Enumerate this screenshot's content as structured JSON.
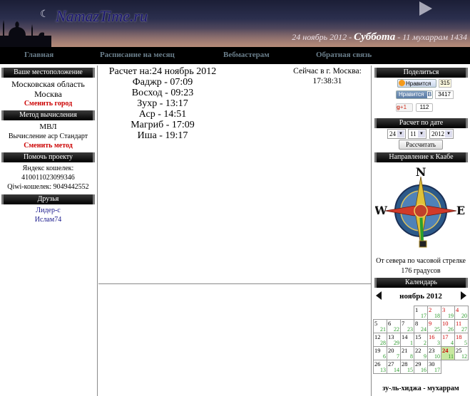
{
  "site": {
    "logo": "NamazTime.ru"
  },
  "header": {
    "date_prefix": "24 ноябрь 2012 - ",
    "day": "Суббота",
    "hijri": " - 11 мухаррам 1434"
  },
  "nav": [
    "Главная",
    "Расписание на месяц",
    "Вебмастерам",
    "Обратная связь"
  ],
  "left": {
    "location_header": "Ваше местоположение",
    "region": "Московская область",
    "city": "Москва",
    "change_city": "Сменить город",
    "method_header": "Метод вычисления",
    "method": "МВЛ",
    "asr_method": "Вычисление аср Стандарт",
    "change_method": "Сменить метод",
    "help_header": "Помочь проекту",
    "yandex_label": "Яндекс кошелек:",
    "yandex_wallet": "410011023099346",
    "qiwi": "Qiwi-кошелек: 9049442552",
    "friends_header": "Друзья",
    "friends": [
      "Лидер-с",
      "Ислам74"
    ]
  },
  "main": {
    "calc_title": "Расчет на:24 ноябрь 2012",
    "times": [
      "Фаджр - 07:09",
      "Восход - 09:23",
      "Зухр - 13:17",
      "Аср - 14:51",
      "Магриб - 17:09",
      "Иша - 19:17"
    ],
    "now_label": "Сейчас в г. Москва:",
    "now_time": "17:38:31"
  },
  "right": {
    "share_header": "Поделиться",
    "ok_label": "Нравится",
    "ok_count": "315",
    "vk_label": "Нравится",
    "vk_count": "3417",
    "gplus_label": "+1",
    "gplus_count": "112",
    "date_header": "Расчет по дате",
    "sel_day": "24",
    "sel_month": "11",
    "sel_year": "2012",
    "calc_button": "Рассчитать",
    "qibla_header": "Направление к Каабе",
    "qibla_text": "От севера по часовой стрелке",
    "qibla_deg": "176 градусов",
    "compass_letters": {
      "n": "N",
      "w": "W",
      "e": "E"
    },
    "calendar_header": "Календарь",
    "month_title": "ноябрь 2012",
    "hijri_months": "зу-ль-хиджа - мухаррам"
  },
  "calendar": [
    [
      null,
      null,
      null,
      {
        "g": "1",
        "h": "17"
      },
      {
        "g": "2",
        "h": "18",
        "f": true
      },
      {
        "g": "3",
        "h": "19",
        "f": true
      },
      {
        "g": "4",
        "h": "20",
        "f": true
      }
    ],
    [
      {
        "g": "5",
        "h": "21"
      },
      {
        "g": "6",
        "h": "22"
      },
      {
        "g": "7",
        "h": "23"
      },
      {
        "g": "8",
        "h": "24"
      },
      {
        "g": "9",
        "h": "25",
        "f": true
      },
      {
        "g": "10",
        "h": "26",
        "f": true
      },
      {
        "g": "11",
        "h": "27",
        "f": true
      }
    ],
    [
      {
        "g": "12",
        "h": "28"
      },
      {
        "g": "13",
        "h": "29"
      },
      {
        "g": "14",
        "h": "1"
      },
      {
        "g": "15",
        "h": "2"
      },
      {
        "g": "16",
        "h": "3",
        "f": true
      },
      {
        "g": "17",
        "h": "4",
        "f": true
      },
      {
        "g": "18",
        "h": "5",
        "f": true
      }
    ],
    [
      {
        "g": "19",
        "h": "6"
      },
      {
        "g": "20",
        "h": "7"
      },
      {
        "g": "21",
        "h": "8"
      },
      {
        "g": "22",
        "h": "9"
      },
      {
        "g": "23",
        "h": "10"
      },
      {
        "g": "24",
        "h": "11",
        "today": true
      },
      {
        "g": "25",
        "h": "12"
      }
    ],
    [
      {
        "g": "26",
        "h": "13"
      },
      {
        "g": "27",
        "h": "14"
      },
      {
        "g": "28",
        "h": "15"
      },
      {
        "g": "29",
        "h": "16"
      },
      {
        "g": "30",
        "h": "17"
      },
      null,
      null
    ]
  ]
}
